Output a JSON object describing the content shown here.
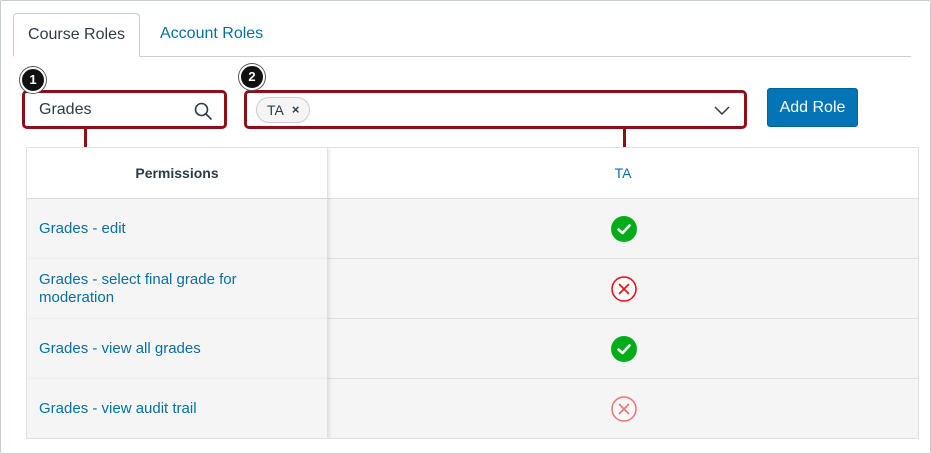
{
  "tabs": [
    {
      "label": "Course Roles",
      "active": true
    },
    {
      "label": "Account Roles",
      "active": false
    }
  ],
  "search": {
    "value": "Grades",
    "icon": "search-icon"
  },
  "role_filter": {
    "chips": [
      {
        "label": "TA",
        "remove": "×"
      }
    ],
    "icon": "chevron-down-icon"
  },
  "add_role_label": "Add Role",
  "callouts": [
    "1",
    "2"
  ],
  "table": {
    "permissions_header": "Permissions",
    "role_header": "TA",
    "rows": [
      {
        "label": "Grades - edit",
        "status": "enabled"
      },
      {
        "label": "Grades - select final grade for moderation",
        "status": "disabled"
      },
      {
        "label": "Grades - view all grades",
        "status": "enabled"
      },
      {
        "label": "Grades - view audit trail",
        "status": "disabled-locked"
      }
    ]
  },
  "colors": {
    "accent": "#0374b5",
    "link": "#0770a3",
    "enabled": "#00ac18",
    "disabled": "#ee0612",
    "callout_border": "#8b1116"
  }
}
